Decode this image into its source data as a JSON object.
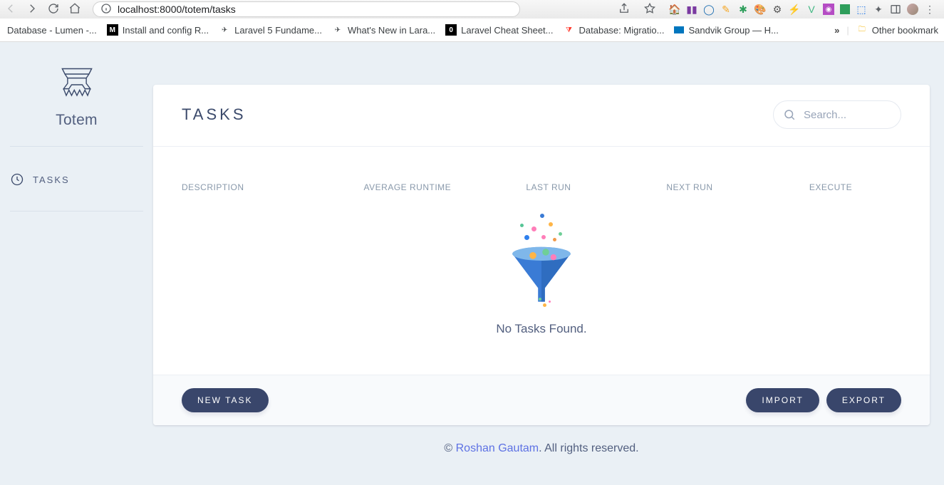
{
  "browser": {
    "url": "localhost:8000/totem/tasks",
    "bookmarks": [
      {
        "label": "Database - Lumen -...",
        "icon": "page"
      },
      {
        "label": "Install and config R...",
        "icon": "M"
      },
      {
        "label": "Laravel 5 Fundame...",
        "icon": "plane"
      },
      {
        "label": "What's New in Lara...",
        "icon": "plane"
      },
      {
        "label": "Laravel Cheat Sheet...",
        "icon": "O"
      },
      {
        "label": "Database: Migratio...",
        "icon": "laravel"
      },
      {
        "label": "Sandvik Group — H...",
        "icon": "sandvik"
      }
    ],
    "other_bookmarks_label": "Other bookmark"
  },
  "sidebar": {
    "brand": "Totem",
    "items": [
      {
        "label": "TASKS"
      }
    ]
  },
  "page": {
    "title": "TASKS",
    "search_placeholder": "Search...",
    "columns": {
      "description": "DESCRIPTION",
      "avg_runtime": "AVERAGE RUNTIME",
      "last_run": "LAST RUN",
      "next_run": "NEXT RUN",
      "execute": "EXECUTE"
    },
    "empty_message": "No Tasks Found.",
    "actions": {
      "new_task": "NEW TASK",
      "import": "IMPORT",
      "export": "EXPORT"
    }
  },
  "footer": {
    "prefix": "© ",
    "author": "Roshan Gautam",
    "suffix": ". All rights reserved."
  }
}
